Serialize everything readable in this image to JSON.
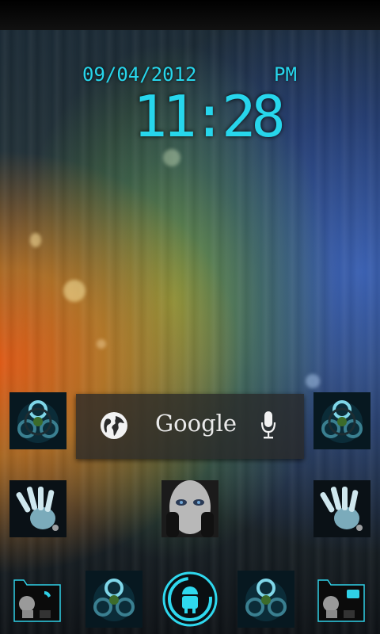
{
  "clock": {
    "date": "09/04/2012",
    "time": "11:28",
    "ampm": "PM"
  },
  "search": {
    "brand": "Google",
    "globe_icon": "globe-icon",
    "mic_icon": "microphone-icon"
  },
  "home_icons": [
    {
      "name": "biohazard-app-icon"
    },
    {
      "name": "biohazard-app-icon"
    },
    {
      "name": "handprint-app-icon"
    },
    {
      "name": "face-app-icon"
    },
    {
      "name": "handprint-app-icon"
    }
  ],
  "dock": [
    {
      "name": "phone-folder-icon"
    },
    {
      "name": "biohazard-app-icon"
    },
    {
      "name": "app-drawer-button"
    },
    {
      "name": "biohazard-app-icon"
    },
    {
      "name": "messaging-folder-icon"
    }
  ],
  "colors": {
    "accent": "#27d6ec",
    "search_bg": "#282828"
  }
}
